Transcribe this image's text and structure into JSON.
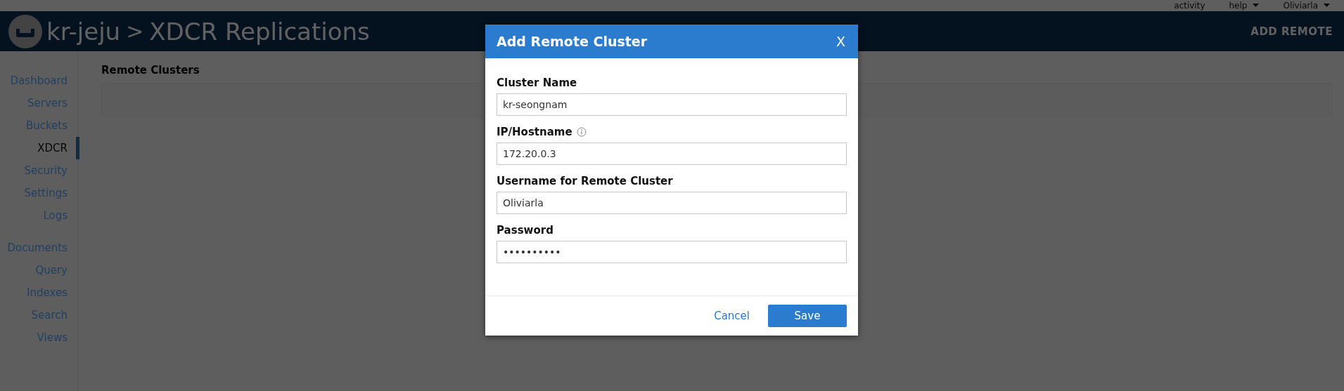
{
  "top_bar": {
    "items": [
      {
        "label": "activity",
        "dropdown": false
      },
      {
        "label": "help",
        "dropdown": true
      },
      {
        "label": "Oliviarla",
        "dropdown": true
      }
    ]
  },
  "header": {
    "cluster": "kr-jeju",
    "separator": ">",
    "page_title": "XDCR Replications",
    "action": "ADD REMOTE"
  },
  "sidebar": {
    "groups": [
      [
        {
          "label": "Dashboard",
          "selected": false
        },
        {
          "label": "Servers",
          "selected": false
        },
        {
          "label": "Buckets",
          "selected": false
        },
        {
          "label": "XDCR",
          "selected": true
        },
        {
          "label": "Security",
          "selected": false
        },
        {
          "label": "Settings",
          "selected": false
        },
        {
          "label": "Logs",
          "selected": false
        }
      ],
      [
        {
          "label": "Documents",
          "selected": false
        },
        {
          "label": "Query",
          "selected": false
        },
        {
          "label": "Indexes",
          "selected": false
        },
        {
          "label": "Search",
          "selected": false
        },
        {
          "label": "Views",
          "selected": false
        }
      ]
    ]
  },
  "content": {
    "section_title": "Remote Clusters"
  },
  "dialog": {
    "title": "Add Remote Cluster",
    "close": "X",
    "fields": [
      {
        "label": "Cluster Name",
        "value": "kr-seongnam",
        "info": false
      },
      {
        "label": "IP/Hostname",
        "value": "172.20.0.3",
        "info": true
      },
      {
        "label": "Username for Remote Cluster",
        "value": "Oliviarla",
        "info": false
      },
      {
        "label": "Password",
        "value": "••••••••••",
        "info": false
      }
    ],
    "buttons": [
      {
        "label": "Cancel",
        "kind": "link"
      },
      {
        "label": "Save",
        "kind": "primary"
      }
    ]
  }
}
